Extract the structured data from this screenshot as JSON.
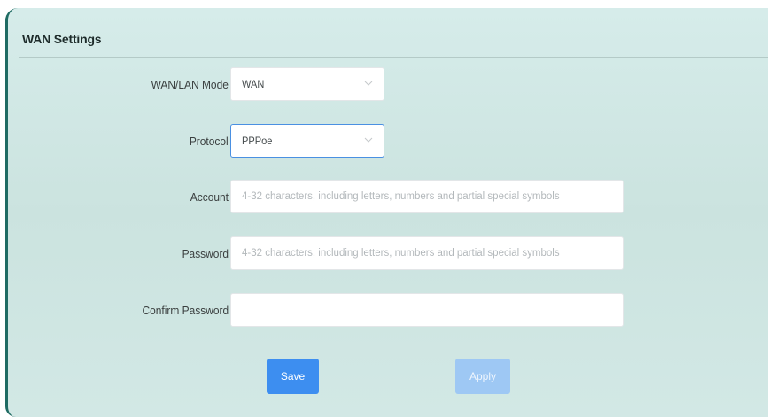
{
  "section": {
    "title": "WAN Settings"
  },
  "form": {
    "wan_lan_mode": {
      "label": "WAN/LAN Mode",
      "value": "WAN"
    },
    "protocol": {
      "label": "Protocol",
      "value": "PPPoe"
    },
    "account": {
      "label": "Account",
      "value": "",
      "placeholder": "4-32 characters, including letters, numbers and partial special symbols"
    },
    "password": {
      "label": "Password",
      "value": "",
      "placeholder": "4-32 characters, including letters, numbers and partial special symbols"
    },
    "confirm_password": {
      "label": "Confirm Password",
      "value": "",
      "placeholder": ""
    }
  },
  "actions": {
    "save_label": "Save",
    "apply_label": "Apply",
    "apply_disabled": true
  },
  "colors": {
    "panel_bg": "#cfe6e3",
    "primary_button": "#3d8ef0",
    "disabled_button": "#9ec8f4",
    "focus_border": "#4a90e2"
  },
  "icons": {
    "dropdown": "chevron-down-icon"
  }
}
